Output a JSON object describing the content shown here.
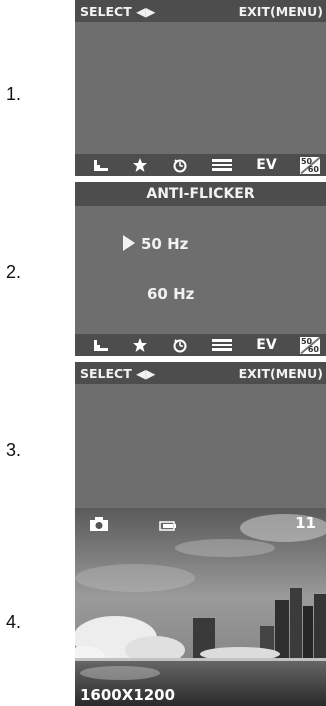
{
  "steps": [
    {
      "number": "1.",
      "select_label": "SELECT ◀▶",
      "exit_label": "EXIT(MENU)"
    },
    {
      "number": "2.",
      "title": "ANTI-FLICKER",
      "options": [
        {
          "label": "50 Hz",
          "selected": true
        },
        {
          "label": "60 Hz",
          "selected": false
        }
      ]
    },
    {
      "number": "3.",
      "select_label": "SELECT ◀▶",
      "exit_label": "EXIT(MENU)"
    },
    {
      "number": "4.",
      "shots_remaining": "11",
      "resolution": "1600X1200"
    }
  ],
  "icon_bar": {
    "icons": [
      "scene-icon",
      "star-icon",
      "self-timer-icon",
      "flash-battery-icon",
      "ev-icon",
      "white-balance-icon"
    ],
    "ev_label": "EV",
    "wb_top": "50",
    "wb_bottom": "60"
  },
  "colors": {
    "screen_bg": "#6e6e6e",
    "bar_bg": "#4d4d4d",
    "text": "#f2f2f2"
  }
}
